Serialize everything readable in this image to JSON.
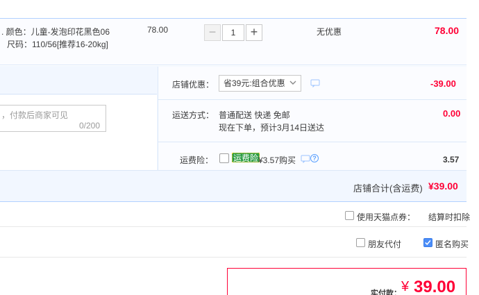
{
  "product": {
    "attr_color": "颜色：儿童-发泡印花黑色06",
    "attr_size": "尺码：110/56[推荐16-20kg]",
    "unit_price": "78.00",
    "quantity": "1",
    "qty_minus": "−",
    "qty_plus": "+",
    "discount": "无优惠",
    "subtotal": "78.00"
  },
  "message": {
    "placeholder": "，付款后商家可见",
    "counter": "0/200"
  },
  "shop_discount": {
    "label": "店铺优惠：",
    "selected": "省39元:组合优惠",
    "value": "-39.00"
  },
  "shipping": {
    "label": "运送方式：",
    "method": "普通配送 快递 免邮",
    "eta": "现在下单，预计3月14日送达",
    "value": "0.00"
  },
  "insurance": {
    "label": "运费险：",
    "badge": "运费险",
    "price_text": "¥3.57购买",
    "value": "3.57"
  },
  "shop_total": {
    "label": "店铺合计(含运费)",
    "value": "¥39.00"
  },
  "options": {
    "tmall_points_label": "使用天猫点券：",
    "tmall_points_note": "结算时扣除",
    "friend_pay_label": "朋友代付",
    "anonymous_label": "匿名购买",
    "anonymous_checked": true
  },
  "payment": {
    "label": "实付款：",
    "currency": "¥",
    "amount": "39.00"
  },
  "colors": {
    "accent_red": "#ff0036",
    "accent_blue": "#4b8df8",
    "badge_green": "#2e9e46"
  }
}
